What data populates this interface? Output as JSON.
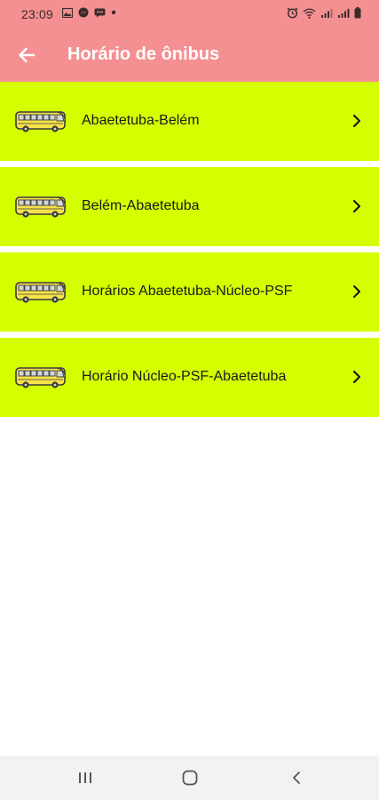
{
  "status_bar": {
    "time": "23:09",
    "left_icons": [
      "image-icon",
      "messenger-icon",
      "chat-icon",
      "dot-icon"
    ],
    "right_icons": [
      "alarm-icon",
      "wifi-icon",
      "signal-icon",
      "signal-icon",
      "battery-icon"
    ]
  },
  "header": {
    "title": "Horário de ônibus",
    "back_icon": "arrow-left-icon",
    "background": "#f49092"
  },
  "routes": [
    {
      "label": "Abaetetuba-Belém"
    },
    {
      "label": "Belém-Abaetetuba"
    },
    {
      "label": "Horários Abaetetuba-Núcleo-PSF"
    },
    {
      "label": "Horário Núcleo-PSF-Abaetetuba"
    }
  ],
  "row_color": "#d4ff00",
  "nav_bar": {
    "buttons": [
      "recent-apps-icon",
      "home-icon",
      "back-icon"
    ]
  }
}
